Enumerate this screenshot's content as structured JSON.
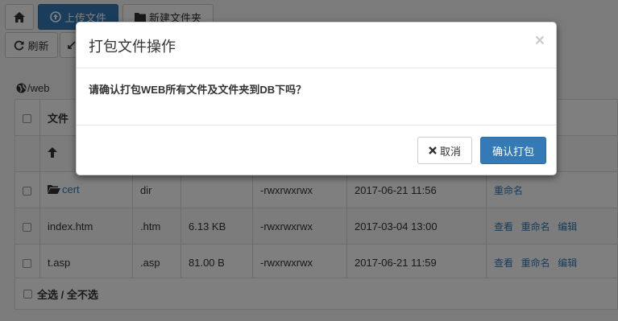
{
  "toolbar": {
    "home_icon": "home-icon",
    "upload_label": "上传文件",
    "upload_icon": "upload-circle-icon",
    "new_folder_label": "新建文件夹",
    "new_folder_icon": "folder-icon",
    "refresh_label": "刷新",
    "refresh_icon": "refresh-icon"
  },
  "path": {
    "icon": "globe-icon",
    "text": "/web"
  },
  "table": {
    "header_name": "文件",
    "rows": [
      {
        "name": "cert",
        "type": "dir",
        "size": "",
        "perms": "-rwxrwxrwx",
        "date": "2017-06-21 11:56",
        "actions": [
          "重命名"
        ]
      },
      {
        "name": "index.htm",
        "type": ".htm",
        "size": "6.13 KB",
        "perms": "-rwxrwxrwx",
        "date": "2017-03-04 13:00",
        "actions": [
          "查看",
          "重命名",
          "编辑"
        ]
      },
      {
        "name": "t.asp",
        "type": ".asp",
        "size": "81.00 B",
        "perms": "-rwxrwxrwx",
        "date": "2017-06-21 11:59",
        "actions": [
          "查看",
          "重命名",
          "编辑"
        ]
      }
    ],
    "footer_label": "全选 / 全不选"
  },
  "modal": {
    "title": "打包文件操作",
    "close": "×",
    "message": "请确认打包WEB所有文件及文件夹到DB下吗？",
    "cancel_label": "取消",
    "confirm_label": "确认打包"
  },
  "colors": {
    "primary": "#337ab7",
    "link": "#337ab7",
    "backdrop": "rgba(0,0,0,0.5)"
  }
}
